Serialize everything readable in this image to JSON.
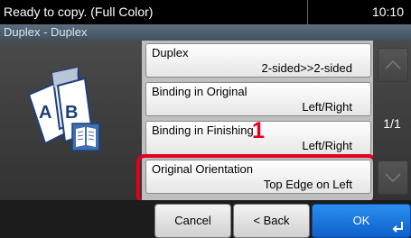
{
  "status": {
    "message": "Ready to copy. (Full Color)",
    "time": "10:10"
  },
  "subtitle": "Duplex - Duplex",
  "options": [
    {
      "label": "Duplex",
      "value": "2-sided>>2-sided"
    },
    {
      "label": "Binding in Original",
      "value": "Left/Right"
    },
    {
      "label": "Binding in Finishing",
      "value": "Left/Right"
    },
    {
      "label": "Original Orientation",
      "value": "Top Edge on Left"
    }
  ],
  "pager": {
    "text": "1/1"
  },
  "callout": "1",
  "buttons": {
    "cancel": "Cancel",
    "back": "< Back",
    "ok": "OK"
  },
  "icons": {
    "duplex": "duplex-document-icon",
    "scroll_up": "scroll-up-icon",
    "scroll_down": "scroll-down-icon",
    "enter": "enter-icon"
  },
  "colors": {
    "highlight": "#e4001f",
    "ok": "#1a72d8"
  }
}
